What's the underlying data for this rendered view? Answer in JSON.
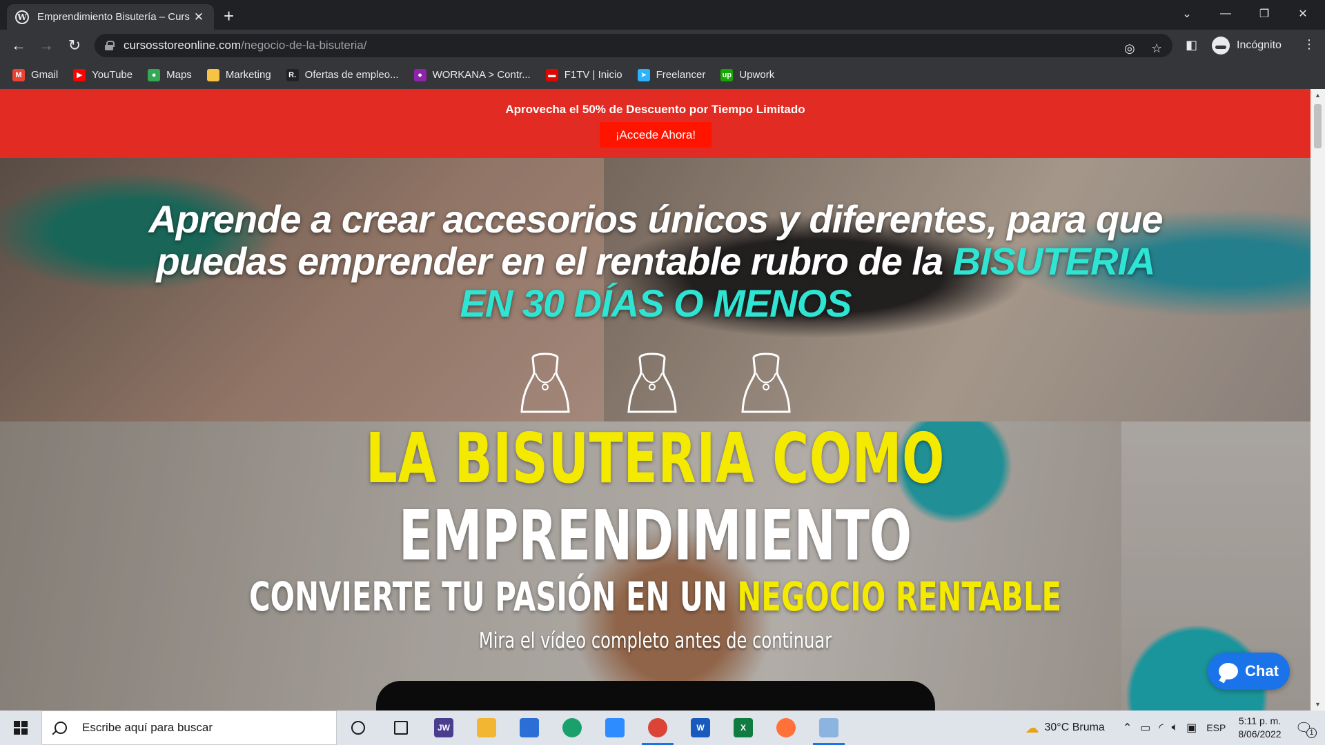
{
  "browser": {
    "tab_title": "Emprendimiento Bisutería – Curs",
    "tab_favicon": "wordpress-icon",
    "url_host": "cursosstoreonline.com",
    "url_path": "/negocio-de-la-bisuteria/",
    "profile_label": "Incógnito",
    "bookmarks": [
      {
        "label": "Gmail",
        "icon": "gmail-icon",
        "color": "#ea4335",
        "glyph": "M"
      },
      {
        "label": "YouTube",
        "icon": "youtube-icon",
        "color": "#ff0000",
        "glyph": "▶"
      },
      {
        "label": "Maps",
        "icon": "maps-icon",
        "color": "#34a853",
        "glyph": "●"
      },
      {
        "label": "Marketing",
        "icon": "folder-icon",
        "color": "#f6c344",
        "glyph": ""
      },
      {
        "label": "Ofertas de empleo...",
        "icon": "r-logo-icon",
        "color": "#202124",
        "glyph": "R."
      },
      {
        "label": "WORKANA > Contr...",
        "icon": "workana-icon",
        "color": "#8e24aa",
        "glyph": "●"
      },
      {
        "label": "F1TV | Inicio",
        "icon": "f1tv-icon",
        "color": "#e10600",
        "glyph": "▬"
      },
      {
        "label": "Freelancer",
        "icon": "freelancer-icon",
        "color": "#29b2fe",
        "glyph": "➤"
      },
      {
        "label": "Upwork",
        "icon": "upwork-icon",
        "color": "#14a800",
        "glyph": "up"
      }
    ]
  },
  "page": {
    "promo_text": "Aprovecha el 50% de Descuento por Tiempo Limitado",
    "promo_button": "¡Accede Ahora!",
    "headline_line1": "Aprende a crear accesorios únicos y diferentes, para que",
    "headline_line2_white": "puedas emprender en el rentable rubro de la ",
    "headline_line2_teal": "BISUTERIA",
    "headline_line3_teal": "EN 30 DÍAS O MENOS",
    "title_line1": "LA BISUTERIA COMO",
    "title_line2": "EMPRENDIMIENTO",
    "subtitle_white": "CONVIERTE TU PASIÓN EN UN ",
    "subtitle_yellow": "NEGOCIO RENTABLE",
    "note": "Mira el vídeo completo antes de continuar",
    "chat_label": "Chat",
    "colors": {
      "promo_bg": "#e22b22",
      "teal": "#2ee5d3",
      "yellow": "#f4ea00",
      "chat": "#1a73e8"
    }
  },
  "taskbar": {
    "search_placeholder": "Escribe aquí para buscar",
    "apps": [
      {
        "name": "cortana-icon"
      },
      {
        "name": "task-view-icon"
      },
      {
        "name": "jw-icon",
        "glyph": "JW",
        "color": "#4a3d8f"
      },
      {
        "name": "file-explorer-icon",
        "color": "#f2b632"
      },
      {
        "name": "store-icon",
        "color": "#2b6fd6"
      },
      {
        "name": "edge-icon",
        "color": "#1aa06b"
      },
      {
        "name": "zoom-icon",
        "color": "#2d8cff"
      },
      {
        "name": "chrome-icon",
        "color": "#db4437"
      },
      {
        "name": "word-icon",
        "glyph": "W",
        "color": "#185abd"
      },
      {
        "name": "excel-icon",
        "glyph": "X",
        "color": "#107c41"
      },
      {
        "name": "firefox-icon",
        "color": "#ff7139"
      },
      {
        "name": "paint-icon",
        "color": "#8bb4e0"
      }
    ],
    "weather": "30°C  Bruma",
    "language": "ESP",
    "time": "5:11 p. m.",
    "date": "8/06/2022",
    "notification_count": "1"
  }
}
